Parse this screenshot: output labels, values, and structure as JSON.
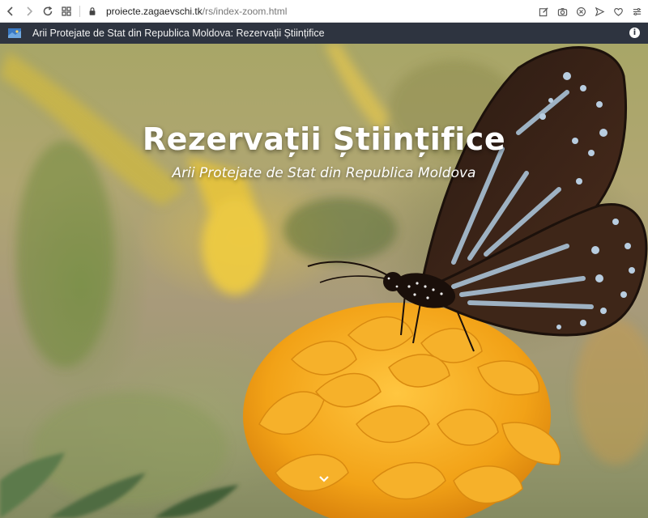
{
  "browser": {
    "url_host": "proiecte.zagaevschi.tk",
    "url_path": "/rs/index-zoom.html"
  },
  "site": {
    "header_title": "Arii Protejate de Stat din Republica Moldova: Rezervații Științifice",
    "info_label": "i"
  },
  "hero": {
    "title": "Rezervații Științifice",
    "subtitle": "Arii Protejate de Stat din Republica Moldova"
  },
  "colors": {
    "header_bg": "#2e3440",
    "hero_text": "#ffffff",
    "flower": "#f2a217",
    "butterfly_dark": "#3a2418",
    "butterfly_spot": "#a9c2d6"
  },
  "icons": [
    "back-icon",
    "forward-icon",
    "reload-icon",
    "tabs-grid-icon",
    "lock-icon",
    "edit-icon",
    "camera-icon",
    "block-icon",
    "send-icon",
    "heart-icon",
    "menu-icon",
    "site-logo-icon",
    "info-icon",
    "chevron-down-icon"
  ]
}
